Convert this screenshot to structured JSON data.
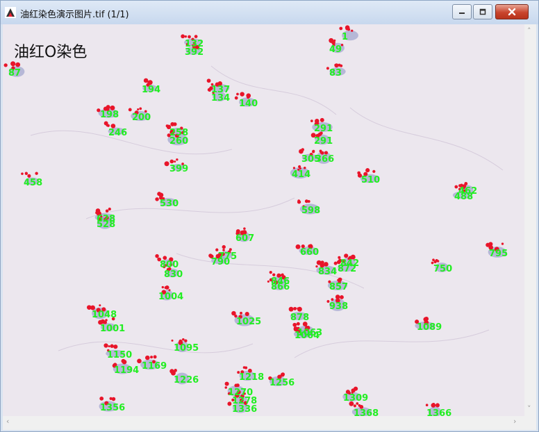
{
  "window": {
    "title": "油红染色演示图片.tif (1/1)",
    "icons": {
      "app": "imagej-icon",
      "minimize": "minimize-icon",
      "maximize": "maximize-icon",
      "close": "close-icon"
    }
  },
  "image": {
    "overlay_label": "油红O染色",
    "id_color": "#22ee22",
    "lipid_color": "#e8152a",
    "nucleus_color": "#8a92c4",
    "cell_ids": [
      "1",
      "49",
      "83",
      "132",
      "392",
      "87",
      "137",
      "134",
      "140",
      "194",
      "198",
      "200",
      "291",
      "246",
      "258",
      "260",
      "291",
      "305",
      "366",
      "399",
      "414",
      "458",
      "462",
      "488",
      "510",
      "528",
      "530",
      "598",
      "607",
      "628",
      "660",
      "750",
      "775",
      "790",
      "795",
      "800",
      "830",
      "834",
      "842",
      "846",
      "857",
      "866",
      "872",
      "878",
      "938",
      "1001",
      "1004",
      "1025",
      "1048",
      "1063",
      "1064",
      "1089",
      "1095",
      "1150",
      "1169",
      "1194",
      "1218",
      "1226",
      "1256",
      "1270",
      "1278",
      "1309",
      "1336",
      "1356",
      "1366",
      "1368"
    ]
  },
  "scrollbars": {
    "left": "‹",
    "right": "›",
    "up": "˄",
    "down": "˅"
  }
}
